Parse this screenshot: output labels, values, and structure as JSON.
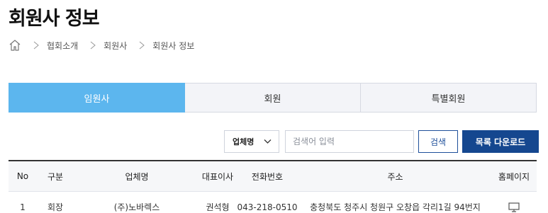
{
  "page": {
    "title": "회원사 정보"
  },
  "breadcrumb": {
    "home_icon": "home-icon",
    "items": [
      "협회소개",
      "회원사",
      "회원사 정보"
    ]
  },
  "tabs": [
    {
      "label": "임원사",
      "active": true
    },
    {
      "label": "회원",
      "active": false
    },
    {
      "label": "특별회원",
      "active": false
    }
  ],
  "search": {
    "select_value": "업체명",
    "placeholder": "검색어 입력",
    "search_label": "검색",
    "download_label": "목록 다운로드"
  },
  "table": {
    "headers": {
      "no": "No",
      "type": "구분",
      "name": "업체명",
      "ceo": "대표이사",
      "tel": "전화번호",
      "addr": "주소",
      "home": "홈페이지"
    },
    "rows": [
      {
        "no": "1",
        "type": "회장",
        "name": "(주)노바렉스",
        "ceo": "권석형",
        "tel": "043-218-0510",
        "addr": "충청북도 청주시 청원구 오창읍 각리1길 94번지",
        "home_icon": "monitor-icon"
      }
    ]
  },
  "colors": {
    "active_tab": "#5cb6ee",
    "primary_button": "#15478f",
    "inactive_tab": "#f3f4f8"
  }
}
